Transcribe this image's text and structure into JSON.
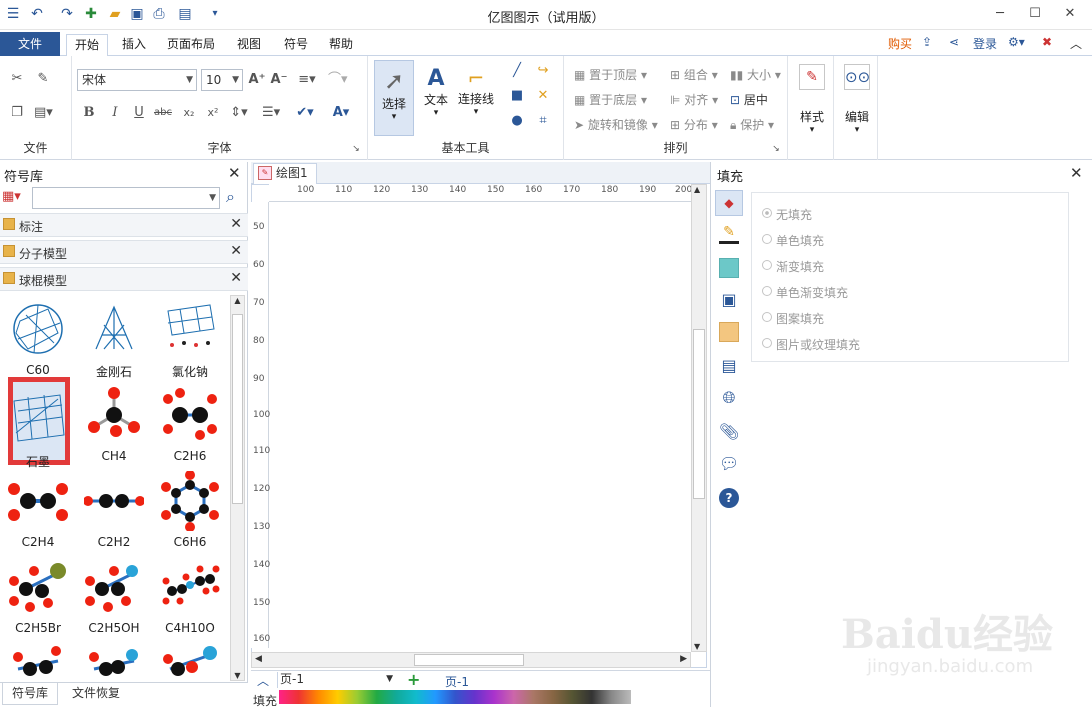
{
  "window": {
    "title": "亿图图示（试用版）"
  },
  "ribbon_tabs": {
    "file": "文件",
    "items": [
      "开始",
      "插入",
      "页面布局",
      "视图",
      "符号",
      "帮助"
    ]
  },
  "account": {
    "buy": "购买",
    "login": "登录"
  },
  "ribbon": {
    "file_group": "文件",
    "font_group": "字体",
    "font_name": "宋体",
    "font_size": "10",
    "basic_tools_group": "基本工具",
    "select_label": "选择",
    "text_label": "文本",
    "connector_label": "连接线",
    "arrange_group": "排列",
    "arrange": {
      "bring_front": "置于顶层",
      "send_back": "置于底层",
      "rotate_mirror": "旋转和镜像",
      "group": "组合",
      "align": "对齐",
      "distribute": "分布",
      "size": "大小",
      "center": "居中",
      "protect": "保护"
    },
    "style_label": "样式",
    "edit_label": "编辑"
  },
  "symbol_library": {
    "title": "符号库",
    "search_placeholder": "",
    "libraries": [
      "标注",
      "分子模型",
      "球棍模型"
    ],
    "symbols": [
      {
        "name": "C60"
      },
      {
        "name": "金刚石"
      },
      {
        "name": "氯化钠"
      },
      {
        "name": "石墨"
      },
      {
        "name": "CH4"
      },
      {
        "name": "C2H6"
      },
      {
        "name": "C2H4"
      },
      {
        "name": "C2H2"
      },
      {
        "name": "C6H6"
      },
      {
        "name": "C2H5Br"
      },
      {
        "name": "C2H5OH"
      },
      {
        "name": "C4H10O"
      }
    ],
    "selected": "石墨",
    "bottom_tabs": [
      "符号库",
      "文件恢复"
    ]
  },
  "document": {
    "tab_title": "绘图1",
    "ruler_h": [
      "100",
      "110",
      "120",
      "130",
      "140",
      "150",
      "160",
      "170",
      "180",
      "190",
      "200"
    ],
    "ruler_v": [
      "50",
      "60",
      "70",
      "80",
      "90",
      "100",
      "110",
      "120",
      "130",
      "140",
      "150",
      "160"
    ],
    "page_selector": "页-1",
    "page_tab": "页-1",
    "palette_label": "填充"
  },
  "fill_panel": {
    "title": "填充",
    "options": [
      "无填充",
      "单色填充",
      "渐变填充",
      "单色渐变填充",
      "图案填充",
      "图片或纹理填充"
    ],
    "selected": "无填充"
  },
  "watermark": {
    "brand": "Baidu经验",
    "url": "jingyan.baidu.com"
  },
  "colors": {
    "accent": "#2b5797",
    "selection": "#e23a3a",
    "buy": "#e05a00"
  }
}
